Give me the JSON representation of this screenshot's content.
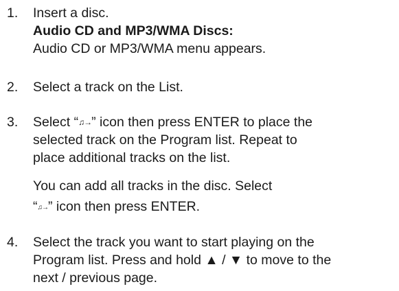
{
  "steps": [
    {
      "number": "1.",
      "line1": "Insert a disc.",
      "bold_line": "Audio CD and MP3/WMA Discs:",
      "line3": "Audio CD or MP3/WMA menu appears."
    },
    {
      "number": "2.",
      "text": "Select a track on the List."
    },
    {
      "number": "3.",
      "pre_icon": "Select “",
      "icon_glyph": "♫→",
      "post_icon_line1": "” icon then press ENTER to place the",
      "line2": "selected track on the Program list. Repeat to",
      "line3": "place additional tracks on the list.",
      "note_line1": "You can add all tracks in the disc. Select",
      "note_pre_icon": "“",
      "note_icon_glyph": "♫→",
      "note_post_icon": "” icon then press ENTER."
    },
    {
      "number": "4.",
      "line1": "Select the track you want to start playing on the",
      "line2": "Program list. Press and hold ▲ / ▼ to move to the",
      "line3": "next / previous page."
    }
  ],
  "icons": {
    "program_add": "program-add-icon",
    "program_add_all": "program-add-all-icon"
  }
}
